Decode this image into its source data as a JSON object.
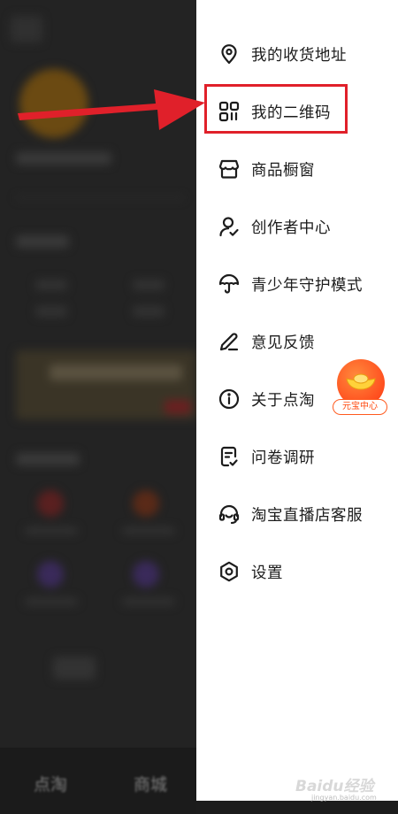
{
  "background": {
    "bottom_tabs": [
      "点淘",
      "商城"
    ]
  },
  "drawer": {
    "menu": [
      {
        "label": "我的收货地址",
        "icon": "location-pin-icon"
      },
      {
        "label": "我的二维码",
        "icon": "qr-code-icon"
      },
      {
        "label": "商品橱窗",
        "icon": "storefront-icon"
      },
      {
        "label": "创作者中心",
        "icon": "creator-user-icon"
      },
      {
        "label": "青少年守护模式",
        "icon": "umbrella-icon"
      },
      {
        "label": "意见反馈",
        "icon": "pencil-icon"
      },
      {
        "label": "关于点淘",
        "icon": "info-icon"
      },
      {
        "label": "问卷调研",
        "icon": "survey-icon"
      },
      {
        "label": "淘宝直播店客服",
        "icon": "headset-icon"
      },
      {
        "label": "设置",
        "icon": "gear-icon"
      }
    ]
  },
  "floating_badge": {
    "label": "元宝中心",
    "icon": "gold-ingot-icon"
  },
  "annotation": {
    "highlight_color": "#e0202a",
    "arrow_color": "#e0202a"
  },
  "watermark": {
    "text": "Baidu经验",
    "sub": "jingyan.baidu.com"
  }
}
